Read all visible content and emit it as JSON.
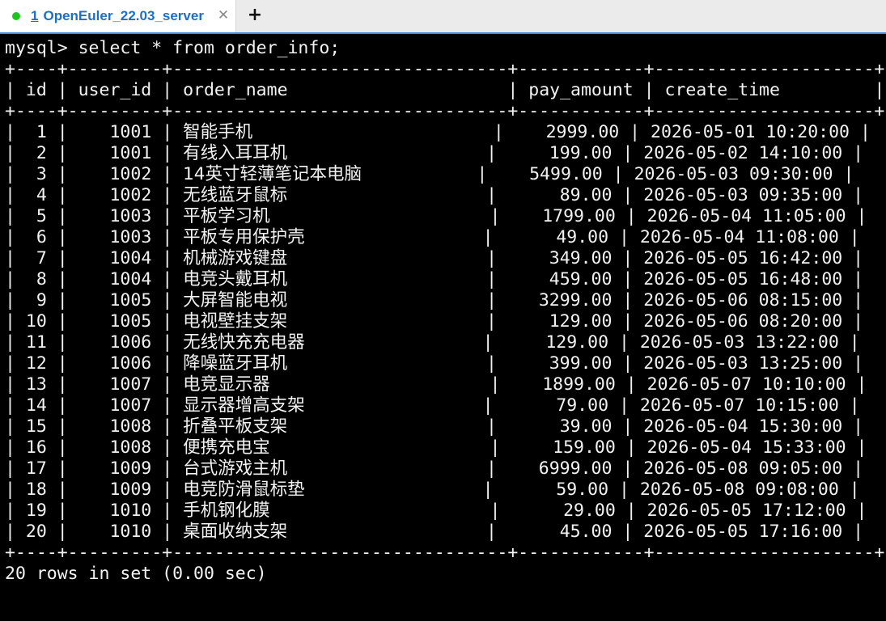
{
  "tab": {
    "number": "1",
    "title": "OpenEuler_22.03_server",
    "status_color": "#1fc41f",
    "close_icon": "✕",
    "new_tab_icon": "+"
  },
  "terminal": {
    "prompt": "mysql> ",
    "command": "select * from order_info;",
    "columns": [
      "id",
      "user_id",
      "order_name",
      "pay_amount",
      "create_time"
    ],
    "rows": [
      [
        "1",
        "1001",
        "智能手机",
        "2999.00",
        "2026-05-01 10:20:00"
      ],
      [
        "2",
        "1001",
        "有线入耳耳机",
        "199.00",
        "2026-05-02 14:10:00"
      ],
      [
        "3",
        "1002",
        "14英寸轻薄笔记本电脑",
        "5499.00",
        "2026-05-03 09:30:00"
      ],
      [
        "4",
        "1002",
        "无线蓝牙鼠标",
        "89.00",
        "2026-05-03 09:35:00"
      ],
      [
        "5",
        "1003",
        "平板学习机",
        "1799.00",
        "2026-05-04 11:05:00"
      ],
      [
        "6",
        "1003",
        "平板专用保护壳",
        "49.00",
        "2026-05-04 11:08:00"
      ],
      [
        "7",
        "1004",
        "机械游戏键盘",
        "349.00",
        "2026-05-05 16:42:00"
      ],
      [
        "8",
        "1004",
        "电竞头戴耳机",
        "459.00",
        "2026-05-05 16:48:00"
      ],
      [
        "9",
        "1005",
        "大屏智能电视",
        "3299.00",
        "2026-05-06 08:15:00"
      ],
      [
        "10",
        "1005",
        "电视壁挂支架",
        "129.00",
        "2026-05-06 08:20:00"
      ],
      [
        "11",
        "1006",
        "无线快充充电器",
        "129.00",
        "2026-05-03 13:22:00"
      ],
      [
        "12",
        "1006",
        "降噪蓝牙耳机",
        "399.00",
        "2026-05-03 13:25:00"
      ],
      [
        "13",
        "1007",
        "电竞显示器",
        "1899.00",
        "2026-05-07 10:10:00"
      ],
      [
        "14",
        "1007",
        "显示器增高支架",
        "79.00",
        "2026-05-07 10:15:00"
      ],
      [
        "15",
        "1008",
        "折叠平板支架",
        "39.00",
        "2026-05-04 15:30:00"
      ],
      [
        "16",
        "1008",
        "便携充电宝",
        "159.00",
        "2026-05-04 15:33:00"
      ],
      [
        "17",
        "1009",
        "台式游戏主机",
        "6999.00",
        "2026-05-08 09:05:00"
      ],
      [
        "18",
        "1009",
        "电竞防滑鼠标垫",
        "59.00",
        "2026-05-08 09:08:00"
      ],
      [
        "19",
        "1010",
        "手机钢化膜",
        "29.00",
        "2026-05-05 17:12:00"
      ],
      [
        "20",
        "1010",
        "桌面收纳支架",
        "45.00",
        "2026-05-05 17:16:00"
      ]
    ],
    "summary": "20 rows in set (0.00 sec)"
  }
}
